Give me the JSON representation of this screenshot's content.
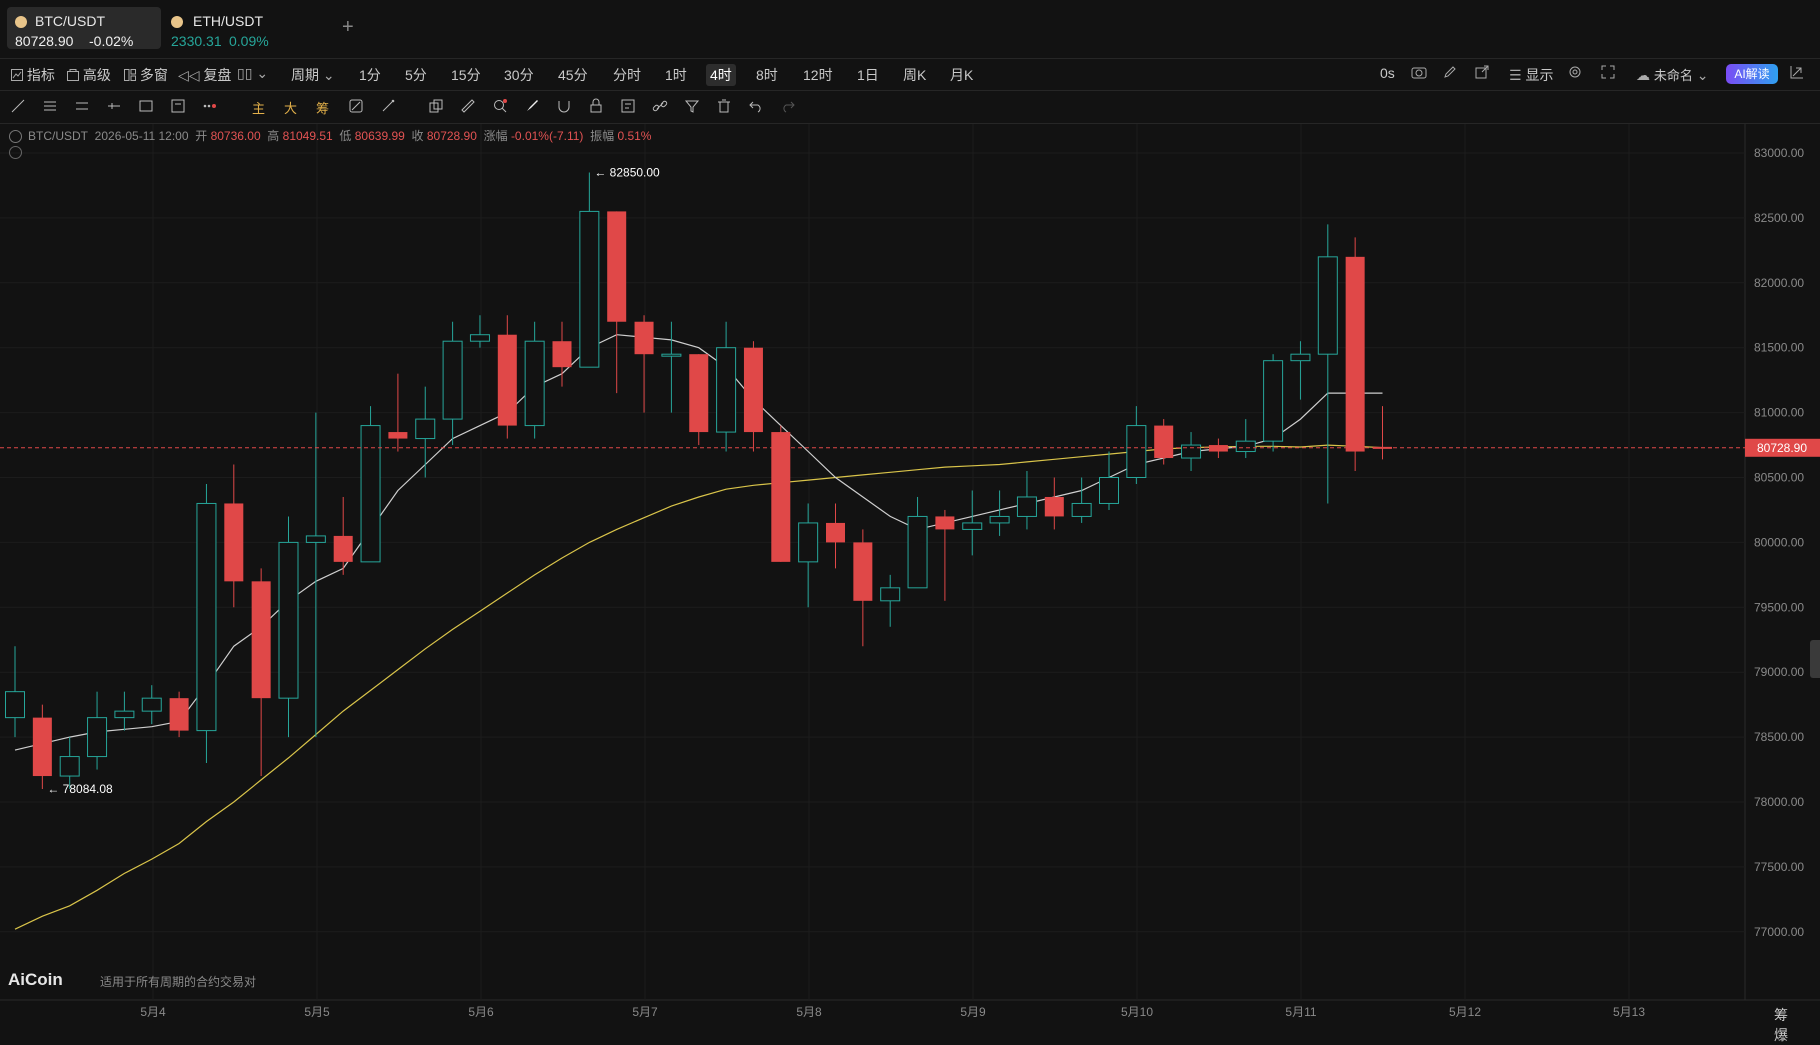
{
  "tabs": [
    {
      "symbol": "BTC/USDT",
      "price": "80728.90",
      "change": "-0.02%",
      "dir": "down",
      "active": true
    },
    {
      "symbol": "ETH/USDT",
      "price": "2330.31",
      "change": "0.09%",
      "dir": "up",
      "active": false
    }
  ],
  "add_tab_label": "+",
  "toolbar": {
    "left_items": [
      "指标",
      "高级",
      "多窗",
      "复盘"
    ],
    "period_label": "周期",
    "periods": [
      "1分",
      "5分",
      "15分",
      "30分",
      "45分",
      "分时",
      "1时",
      "4时",
      "8时",
      "12时",
      "1日",
      "周K",
      "月K"
    ],
    "selected_period": "4时",
    "countdown": "0s",
    "display_label": "显示",
    "layout_name": "未命名",
    "ai_label": "AI解读"
  },
  "drawbar": {
    "main_label": "主",
    "big_label": "大",
    "chip_label": "筹"
  },
  "legend": {
    "symbol": "BTC/USDT",
    "datetime": "2026-05-11 12:00",
    "open_label": "开",
    "open": "80736.00",
    "high_label": "高",
    "high": "81049.51",
    "low_label": "低",
    "low": "80639.99",
    "close_label": "收",
    "close": "80728.90",
    "change_label": "涨幅",
    "change": "-0.01%(-7.11)",
    "amp_label": "振幅",
    "amp": "0.51%"
  },
  "watermark": {
    "brand": "AiCoin",
    "note": "适用于所有周期的合约交易对"
  },
  "bottom_right_label": "筹 爆",
  "colors": {
    "up": "#26a69a",
    "down": "#e04848",
    "ma_fast": "#cfcfcf",
    "ma_slow": "#d9c44a",
    "bg": "#121212",
    "current_price": "#e04848"
  },
  "chart_data": {
    "type": "candlestick",
    "ylim": [
      76700,
      83300
    ],
    "y_ticks": [
      "83000.00",
      "82500.00",
      "82000.00",
      "81500.00",
      "81000.00",
      "80500.00",
      "80000.00",
      "79500.00",
      "79000.00",
      "78500.00",
      "78000.00",
      "77500.00",
      "77000.00"
    ],
    "x_ticks": [
      "5月4",
      "5月5",
      "5月6",
      "5月7",
      "5月8",
      "5月9",
      "5月10",
      "5月11",
      "5月12",
      "5月13"
    ],
    "current_price": "80728.90",
    "annotations": {
      "max": "82850.00",
      "min": "78084.08"
    },
    "candles": [
      [
        78650,
        78850,
        78500,
        79200
      ],
      [
        78650,
        78200,
        78100,
        78750
      ],
      [
        78200,
        78350,
        78100,
        78500
      ],
      [
        78350,
        78650,
        78250,
        78850
      ],
      [
        78650,
        78700,
        78550,
        78850
      ],
      [
        78700,
        78800,
        78600,
        78900
      ],
      [
        78800,
        78550,
        78500,
        78850
      ],
      [
        78550,
        80300,
        78300,
        80450
      ],
      [
        80300,
        79700,
        79500,
        80600
      ],
      [
        79700,
        78800,
        78200,
        79800
      ],
      [
        78800,
        80000,
        78500,
        80200
      ],
      [
        80000,
        80050,
        78500,
        81000
      ],
      [
        80050,
        79850,
        79750,
        80350
      ],
      [
        79850,
        80900,
        79850,
        81050
      ],
      [
        80850,
        80800,
        80700,
        81300
      ],
      [
        80800,
        80950,
        80500,
        81200
      ],
      [
        80950,
        81550,
        80750,
        81700
      ],
      [
        81550,
        81600,
        81500,
        81750
      ],
      [
        81600,
        80900,
        80800,
        81750
      ],
      [
        80900,
        81550,
        80800,
        81700
      ],
      [
        81550,
        81350,
        81200,
        81700
      ],
      [
        81350,
        82550,
        81350,
        82850
      ],
      [
        82550,
        81700,
        81150,
        82550
      ],
      [
        81700,
        81450,
        81000,
        81750
      ],
      [
        81450,
        81450,
        81000,
        81700
      ],
      [
        81450,
        80850,
        80750,
        81450
      ],
      [
        80850,
        81500,
        80700,
        81700
      ],
      [
        81500,
        80850,
        80700,
        81550
      ],
      [
        80850,
        79850,
        79850,
        80900
      ],
      [
        79850,
        80150,
        79500,
        80300
      ],
      [
        80150,
        80000,
        79800,
        80300
      ],
      [
        80000,
        79550,
        79200,
        80100
      ],
      [
        79550,
        79650,
        79350,
        79750
      ],
      [
        79650,
        80200,
        79650,
        80350
      ],
      [
        80200,
        80100,
        79550,
        80250
      ],
      [
        80100,
        80150,
        79900,
        80400
      ],
      [
        80150,
        80200,
        80050,
        80400
      ],
      [
        80200,
        80350,
        80100,
        80550
      ],
      [
        80350,
        80200,
        80100,
        80500
      ],
      [
        80200,
        80300,
        80150,
        80500
      ],
      [
        80300,
        80500,
        80250,
        80700
      ],
      [
        80500,
        80900,
        80450,
        81050
      ],
      [
        80900,
        80650,
        80600,
        80950
      ],
      [
        80650,
        80750,
        80550,
        80850
      ],
      [
        80750,
        80700,
        80650,
        80800
      ],
      [
        80700,
        80780,
        80650,
        80950
      ],
      [
        80780,
        81400,
        80700,
        81450
      ],
      [
        81400,
        81450,
        81100,
        81550
      ],
      [
        81450,
        82200,
        80300,
        82450
      ],
      [
        82200,
        80700,
        80550,
        82350
      ],
      [
        80736,
        80729,
        80640,
        81050
      ]
    ],
    "ma_fast": [
      78400,
      78450,
      78500,
      78540,
      78560,
      78580,
      78620,
      78900,
      79200,
      79350,
      79550,
      79700,
      79800,
      80100,
      80400,
      80600,
      80800,
      80900,
      81000,
      81200,
      81300,
      81500,
      81600,
      81580,
      81560,
      81500,
      81350,
      81100,
      80900,
      80700,
      80500,
      80350,
      80200,
      80100,
      80150,
      80200,
      80250,
      80300,
      80350,
      80400,
      80500,
      80600,
      80650,
      80700,
      80720,
      80740,
      80800,
      80950,
      81150,
      81150,
      81150
    ],
    "ma_slow": [
      77020,
      77120,
      77200,
      77320,
      77450,
      77560,
      77680,
      77850,
      78000,
      78170,
      78340,
      78520,
      78700,
      78860,
      79020,
      79180,
      79330,
      79470,
      79610,
      79750,
      79880,
      80000,
      80100,
      80190,
      80280,
      80350,
      80410,
      80440,
      80460,
      80480,
      80500,
      80520,
      80540,
      80560,
      80580,
      80590,
      80600,
      80620,
      80640,
      80660,
      80680,
      80700,
      80720,
      80730,
      80735,
      80740,
      80740,
      80735,
      80750,
      80740,
      80730
    ]
  }
}
